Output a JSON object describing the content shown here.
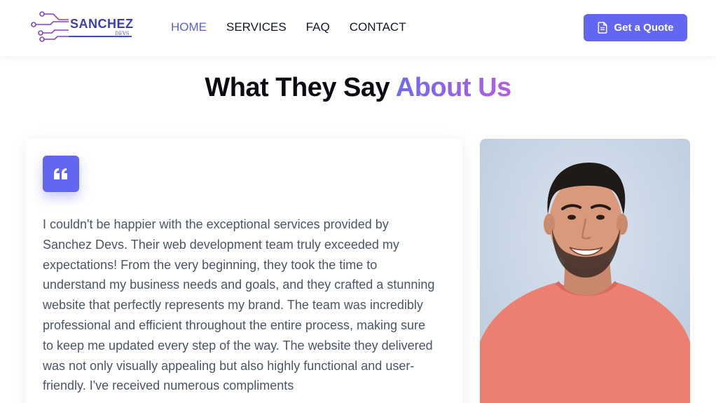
{
  "brand": {
    "name": "SANCHEZ",
    "sub": "DEVS",
    "primary_color": "#6366f1",
    "gradient_start": "#6d6af0",
    "gradient_end": "#b45ee0"
  },
  "nav": {
    "items": [
      {
        "label": "HOME",
        "active": true
      },
      {
        "label": "SERVICES",
        "active": false
      },
      {
        "label": "FAQ",
        "active": false
      },
      {
        "label": "CONTACT",
        "active": false
      }
    ]
  },
  "header": {
    "cta_label": "Get a Quote",
    "cta_icon": "document-icon"
  },
  "section": {
    "title_main": "What They Say ",
    "title_accent": "About Us"
  },
  "testimonial": {
    "icon": "quote-icon",
    "text": "I couldn't be happier with the exceptional services provided by Sanchez Devs. Their web development team truly exceeded my expectations! From the very beginning, they took the time to understand my business needs and goals, and they crafted a stunning website that perfectly represents my brand. The team was incredibly professional and efficient throughout the entire process, making sure to keep me updated every step of the way. The website they delivered was not only visually appealing but also highly functional and user-friendly. I've received numerous compliments"
  },
  "photo": {
    "subject": "smiling man in salmon t-shirt",
    "background_color": "#c9d7e8",
    "shirt_color": "#ec7f72"
  }
}
